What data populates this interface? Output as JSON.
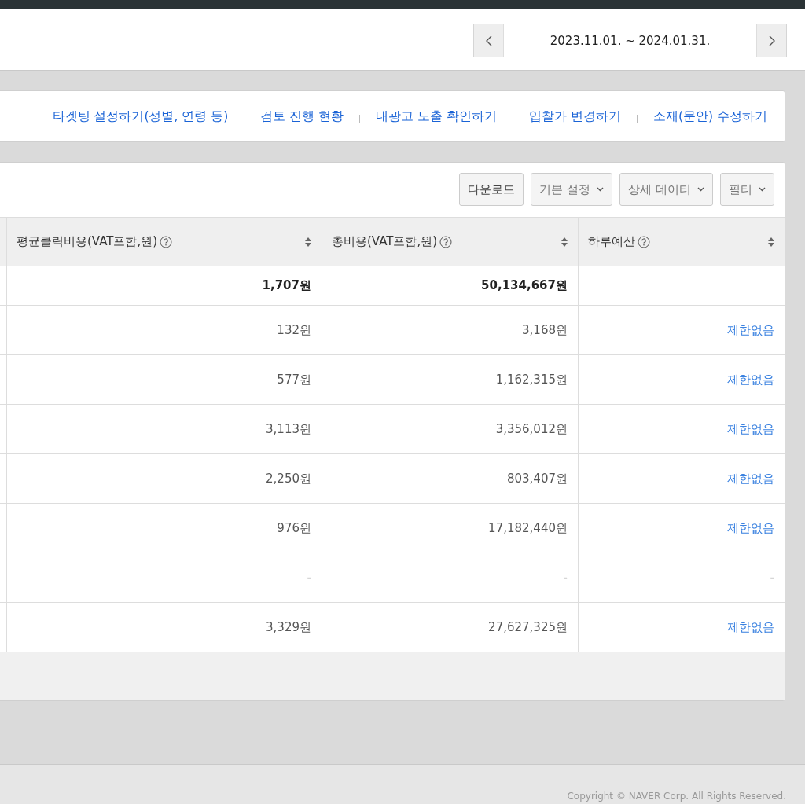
{
  "date_range": {
    "label": "2023.11.01. ~ 2024.01.31."
  },
  "quick_links": [
    "타겟팅 설정하기(성별, 연령 등)",
    "검토 진행 현황",
    "내광고 노출 확인하기",
    "입찰가 변경하기",
    "소재(문안) 수정하기"
  ],
  "toolbar": [
    {
      "label": "다운로드",
      "kind": "button"
    },
    {
      "label": "기본 설정",
      "kind": "dropdown"
    },
    {
      "label": "상세 데이터",
      "kind": "dropdown"
    },
    {
      "label": "필터",
      "kind": "dropdown"
    }
  ],
  "table": {
    "columns": [
      "평균클릭비용(VAT포함,원)",
      "총비용(VAT포함,원)",
      "하루예산"
    ],
    "rows": [
      {
        "kind": "total",
        "avg_cpc": "1,707원",
        "total_cost": "50,134,667원"
      },
      {
        "kind": "normal",
        "avg_cpc": "132원",
        "total_cost": "3,168원",
        "daily_budget": {
          "text": "제한없음",
          "kind": "link"
        }
      },
      {
        "kind": "normal",
        "avg_cpc": "577원",
        "total_cost": "1,162,315원",
        "daily_budget": {
          "text": "제한없음",
          "kind": "link"
        }
      },
      {
        "kind": "normal",
        "avg_cpc": "3,113원",
        "total_cost": "3,356,012원",
        "daily_budget": {
          "text": "제한없음",
          "kind": "link"
        }
      },
      {
        "kind": "normal",
        "avg_cpc": "2,250원",
        "total_cost": "803,407원",
        "daily_budget": {
          "text": "제한없음",
          "kind": "link"
        }
      },
      {
        "kind": "normal",
        "avg_cpc": "976원",
        "total_cost": "17,182,440원",
        "daily_budget": {
          "text": "제한없음",
          "kind": "link"
        }
      },
      {
        "kind": "normal",
        "avg_cpc": "-",
        "total_cost": "-",
        "daily_budget": {
          "text": "-",
          "kind": "plain"
        }
      },
      {
        "kind": "normal",
        "avg_cpc": "3,329원",
        "total_cost": "27,627,325원",
        "daily_budget": {
          "text": "제한없음",
          "kind": "link"
        }
      }
    ]
  },
  "footer": {
    "copyright": "Copyright © NAVER Corp. All Rights Reserved."
  }
}
